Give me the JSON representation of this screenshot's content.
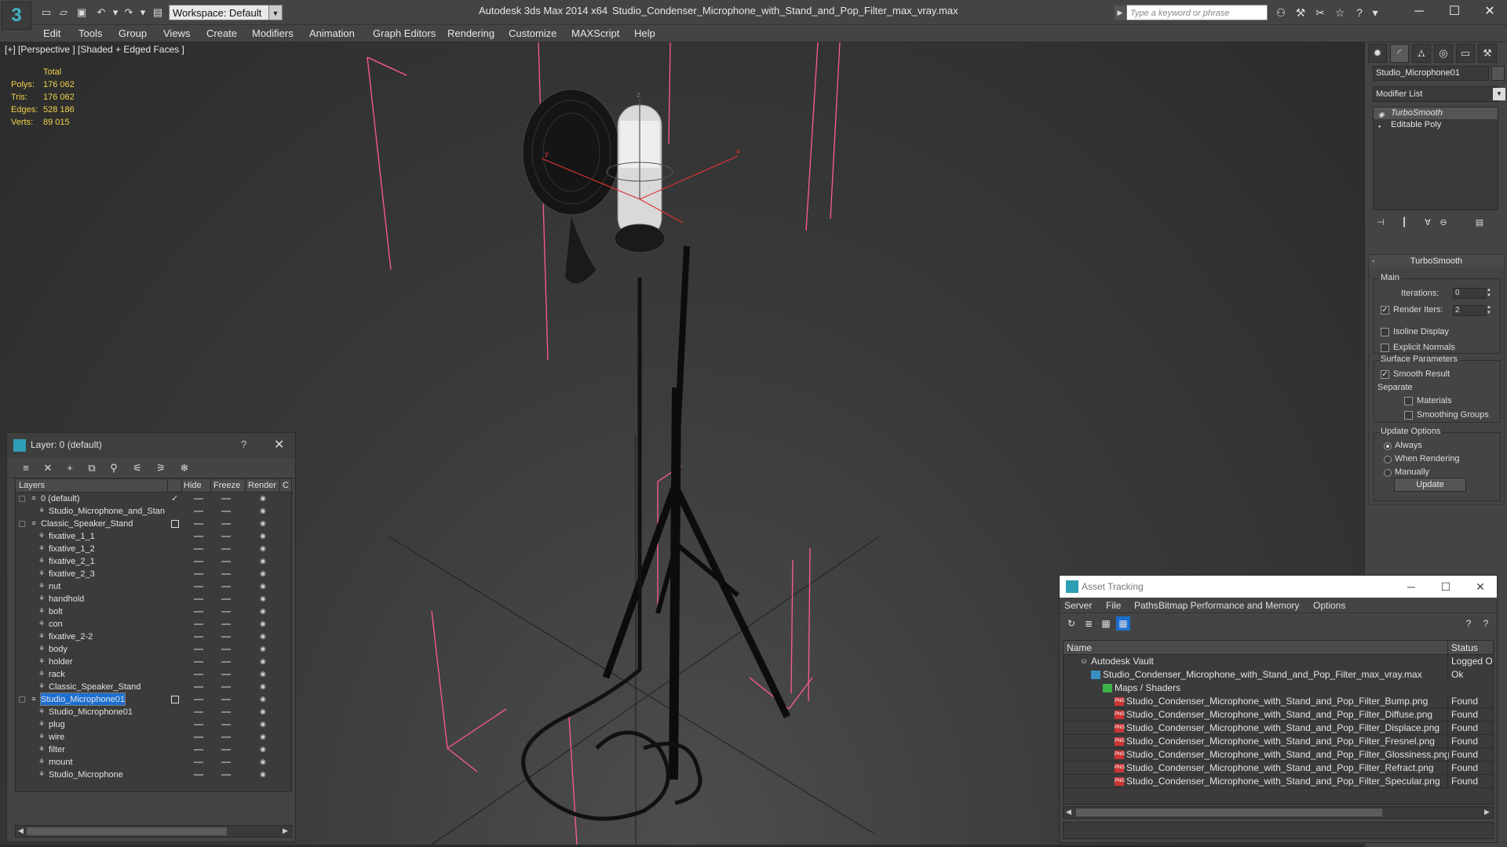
{
  "titlebar": {
    "workspace": "Workspace: Default",
    "app": "Autodesk 3ds Max  2014 x64",
    "file": "Studio_Condenser_Microphone_with_Stand_and_Pop_Filter_max_vray.max",
    "search_placeholder": "Type a keyword or phrase"
  },
  "menu": [
    "Edit",
    "Tools",
    "Group",
    "Views",
    "Create",
    "Modifiers",
    "Animation",
    "Graph Editors",
    "Rendering",
    "Customize",
    "MAXScript",
    "Help"
  ],
  "viewport": {
    "label": "[+] [Perspective ] [Shaded + Edged Faces ]",
    "stats_header": "Total",
    "stats": [
      {
        "name": "Polys:",
        "value": "176 062"
      },
      {
        "name": "Tris:",
        "value": "176 062"
      },
      {
        "name": "Edges:",
        "value": "528 186"
      },
      {
        "name": "Verts:",
        "value": "89 015"
      }
    ],
    "axis_labels": {
      "x": "x",
      "y": "y",
      "z": "z"
    }
  },
  "layer_dialog": {
    "title": "Layer: 0 (default)",
    "help": "?",
    "columns": {
      "layers": "Layers",
      "hide": "Hide",
      "freeze": "Freeze",
      "render": "Render",
      "c": "C"
    },
    "rows": [
      {
        "name": "0 (default)",
        "level": 0,
        "type": "layer",
        "check": "✓"
      },
      {
        "name": "Studio_Microphone_and_Stan",
        "level": 1,
        "type": "object"
      },
      {
        "name": "Classic_Speaker_Stand",
        "level": 0,
        "type": "layer",
        "check": "box"
      },
      {
        "name": "fixative_1_1",
        "level": 1,
        "type": "object"
      },
      {
        "name": "fixative_1_2",
        "level": 1,
        "type": "object"
      },
      {
        "name": "fixative_2_1",
        "level": 1,
        "type": "object"
      },
      {
        "name": "fixative_2_3",
        "level": 1,
        "type": "object"
      },
      {
        "name": "nut",
        "level": 1,
        "type": "object"
      },
      {
        "name": "handhold",
        "level": 1,
        "type": "object"
      },
      {
        "name": "bolt",
        "level": 1,
        "type": "object"
      },
      {
        "name": "con",
        "level": 1,
        "type": "object"
      },
      {
        "name": "fixative_2-2",
        "level": 1,
        "type": "object"
      },
      {
        "name": "body",
        "level": 1,
        "type": "object"
      },
      {
        "name": "holder",
        "level": 1,
        "type": "object"
      },
      {
        "name": "rack",
        "level": 1,
        "type": "object"
      },
      {
        "name": "Classic_Speaker_Stand",
        "level": 1,
        "type": "object"
      },
      {
        "name": "Studio_Microphone01",
        "level": 0,
        "type": "layer",
        "check": "box",
        "selected": true
      },
      {
        "name": "Studio_Microphone01",
        "level": 1,
        "type": "object"
      },
      {
        "name": "plug",
        "level": 1,
        "type": "object"
      },
      {
        "name": "wire",
        "level": 1,
        "type": "object"
      },
      {
        "name": "filter",
        "level": 1,
        "type": "object"
      },
      {
        "name": "mount",
        "level": 1,
        "type": "object"
      },
      {
        "name": "Studio_Microphone",
        "level": 1,
        "type": "object"
      }
    ]
  },
  "command_panel": {
    "object_name": "Studio_Microphone01",
    "modifier_list": "Modifier List",
    "stack": [
      "TurboSmooth",
      "Editable Poly"
    ],
    "rollout_title": "TurboSmooth",
    "main_group": "Main",
    "iterations_label": "Iterations:",
    "iterations_value": "0",
    "render_iters_label": "Render Iters:",
    "render_iters_value": "2",
    "isoline_label": "Isoline Display",
    "explicit_label": "Explicit Normals",
    "surface_group": "Surface Parameters",
    "smooth_label": "Smooth Result",
    "separate_label": "Separate",
    "materials_label": "Materials",
    "smoothing_label": "Smoothing Groups",
    "update_group": "Update Options",
    "always_label": "Always",
    "when_rendering_label": "When Rendering",
    "manually_label": "Manually",
    "update_button": "Update"
  },
  "asset_tracking": {
    "title": "Asset Tracking",
    "menu": [
      "Server",
      "File",
      "Paths",
      "Bitmap Performance and Memory",
      "Options"
    ],
    "col_name": "Name",
    "col_status": "Status",
    "rows": [
      {
        "name": "Autodesk Vault",
        "status": "Logged Ou",
        "icon": "vault",
        "level": 0
      },
      {
        "name": "Studio_Condenser_Microphone_with_Stand_and_Pop_Filter_max_vray.max",
        "status": "Ok",
        "icon": "max",
        "level": 1
      },
      {
        "name": "Maps / Shaders",
        "status": "",
        "icon": "folder",
        "level": 2
      },
      {
        "name": "Studio_Condenser_Microphone_with_Stand_and_Pop_Filter_Bump.png",
        "status": "Found",
        "icon": "png",
        "level": 3
      },
      {
        "name": "Studio_Condenser_Microphone_with_Stand_and_Pop_Filter_Diffuse.png",
        "status": "Found",
        "icon": "png",
        "level": 3
      },
      {
        "name": "Studio_Condenser_Microphone_with_Stand_and_Pop_Filter_Displace.png",
        "status": "Found",
        "icon": "png",
        "level": 3
      },
      {
        "name": "Studio_Condenser_Microphone_with_Stand_and_Pop_Filter_Fresnel.png",
        "status": "Found",
        "icon": "png",
        "level": 3
      },
      {
        "name": "Studio_Condenser_Microphone_with_Stand_and_Pop_Filter_Glossiness.png",
        "status": "Found",
        "icon": "png",
        "level": 3
      },
      {
        "name": "Studio_Condenser_Microphone_with_Stand_and_Pop_Filter_Refract.png",
        "status": "Found",
        "icon": "png",
        "level": 3
      },
      {
        "name": "Studio_Condenser_Microphone_with_Stand_and_Pop_Filter_Specular.png",
        "status": "Found",
        "icon": "png",
        "level": 3
      }
    ]
  },
  "colors": {
    "accent": "#1c6fd1",
    "bbox": "#ff5c8a",
    "stats": "#f0d24a",
    "brand": "#3fb3c6"
  }
}
